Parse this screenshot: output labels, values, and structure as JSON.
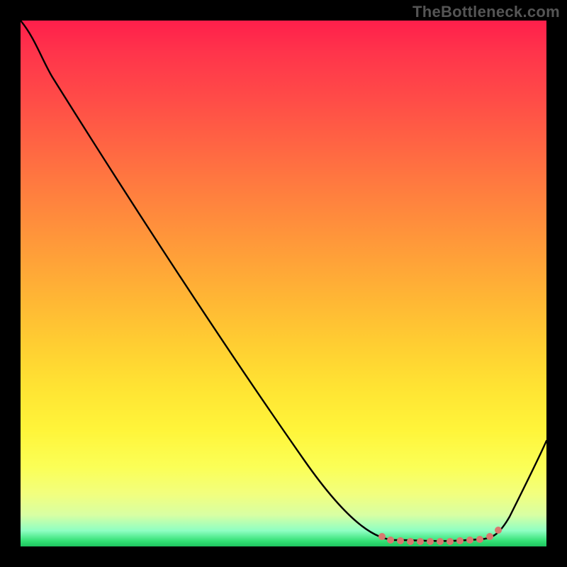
{
  "watermark": "TheBottleneck.com",
  "chart_data": {
    "type": "line",
    "title": "",
    "xlabel": "",
    "ylabel": "",
    "x": [
      0.0,
      0.05,
      0.1,
      0.15,
      0.2,
      0.25,
      0.3,
      0.35,
      0.4,
      0.45,
      0.5,
      0.55,
      0.6,
      0.65,
      0.7,
      0.73,
      0.76,
      0.8,
      0.84,
      0.88,
      0.92,
      0.96,
      1.0
    ],
    "values": [
      1.0,
      0.96,
      0.89,
      0.81,
      0.73,
      0.65,
      0.57,
      0.49,
      0.41,
      0.33,
      0.26,
      0.18,
      0.11,
      0.05,
      0.015,
      0.005,
      0.003,
      0.003,
      0.003,
      0.006,
      0.05,
      0.12,
      0.2
    ],
    "xlim": [
      0,
      1
    ],
    "ylim": [
      0,
      1
    ],
    "marker_region_x": [
      0.7,
      0.9
    ],
    "gradient_stops": [
      {
        "pos": 0.0,
        "color": "#ff1f4b"
      },
      {
        "pos": 0.5,
        "color": "#ffb030"
      },
      {
        "pos": 0.85,
        "color": "#f8ff60"
      },
      {
        "pos": 1.0,
        "color": "#1ec45f"
      }
    ]
  }
}
